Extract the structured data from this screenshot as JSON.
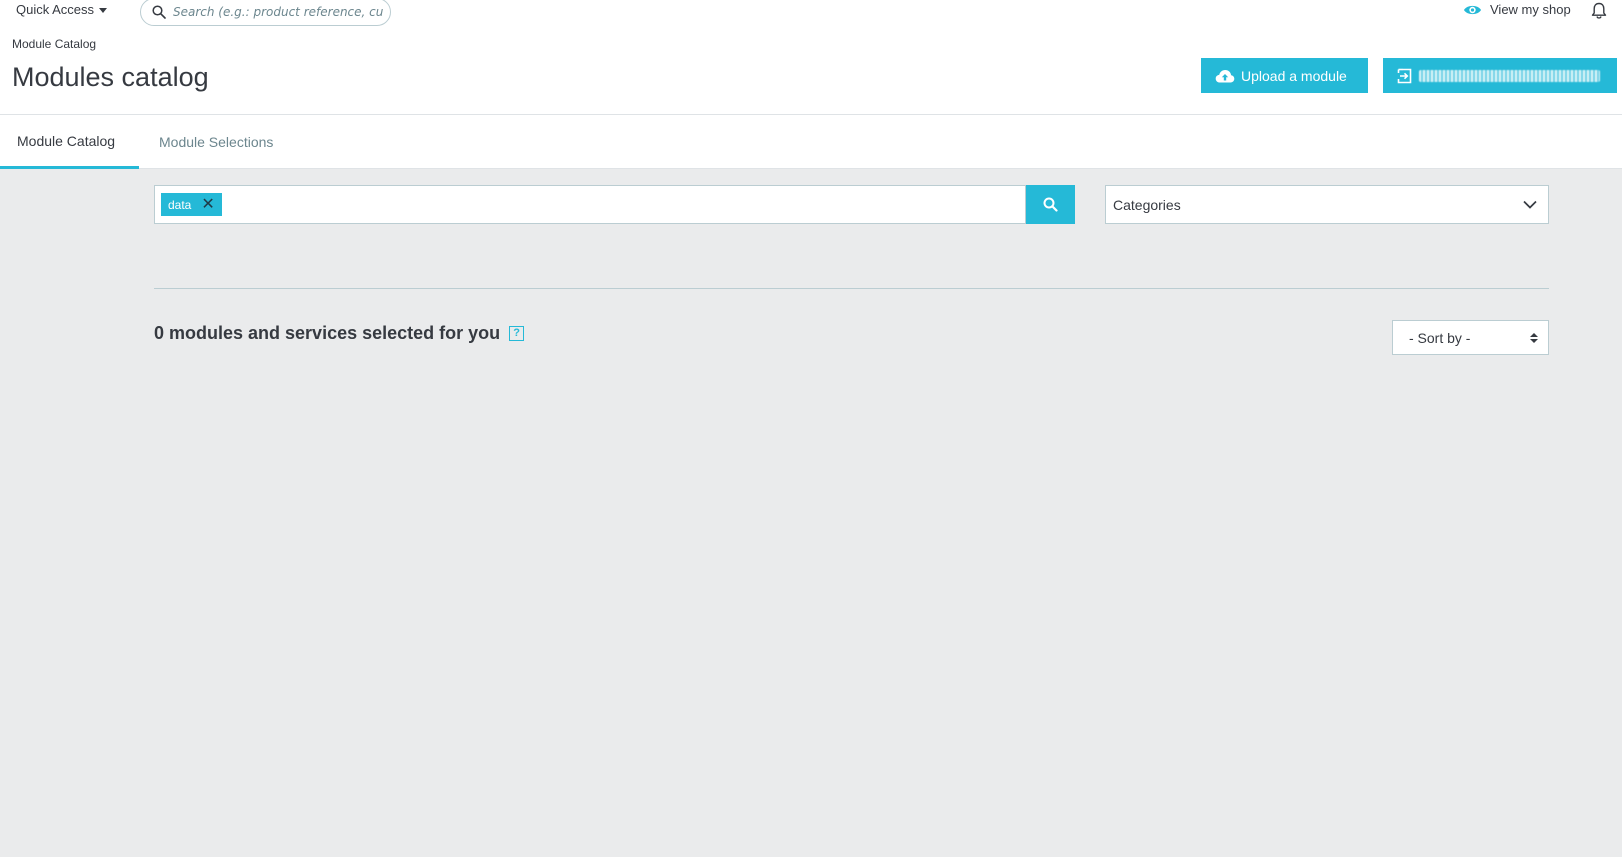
{
  "header": {
    "quick_access_label": "Quick Access",
    "search_placeholder": "Search (e.g.: product reference, customer name…)",
    "view_shop_label": "View my shop"
  },
  "breadcrumb": "Module Catalog",
  "page_title": "Modules catalog",
  "toolbar": {
    "upload_label": "Upload a module",
    "connect_label_redacted": true
  },
  "tabs": [
    {
      "label": "Module Catalog",
      "active": true
    },
    {
      "label": "Module Selections",
      "active": false
    }
  ],
  "filters": {
    "search_tags": [
      "data"
    ],
    "categories_label": "Categories"
  },
  "results": {
    "count_text": "0 modules and services selected for you",
    "help_icon_label": "?",
    "sort_label": "- Sort by -"
  },
  "colors": {
    "accent": "#25b9d7",
    "main_bg": "#eaebec",
    "border": "#bbcdd2",
    "text": "#363a41"
  },
  "icons": [
    "caret-down-icon",
    "search-icon",
    "eye-icon",
    "bell-icon",
    "cloud-upload-icon",
    "sign-in-icon",
    "close-icon",
    "chevron-down-icon",
    "help-icon",
    "sort-arrows-icon"
  ]
}
